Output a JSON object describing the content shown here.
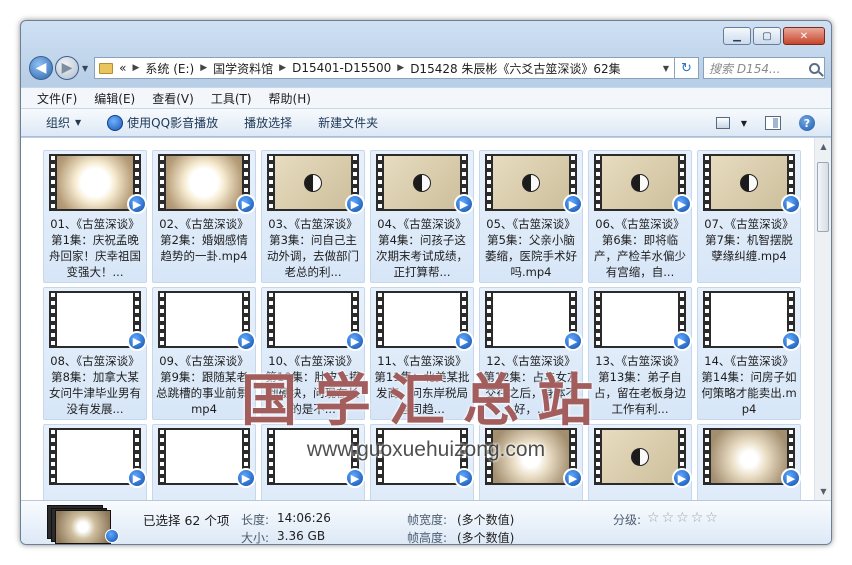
{
  "window": {
    "controls": {
      "minimize": "▁",
      "maximize": "▢",
      "close": "✕"
    }
  },
  "nav": {
    "back_glyph": "◀",
    "fwd_glyph": "▶",
    "breadcrumb_lead": "«",
    "breadcrumbs": [
      "系统 (E:)",
      "国学资料馆",
      "D15401-D15500",
      "D15428 朱辰彬《六爻古筮深谈》62集"
    ],
    "refresh_glyph": "↻",
    "search_placeholder": "搜索 D154..."
  },
  "menu": [
    "文件(F)",
    "编辑(E)",
    "查看(V)",
    "工具(T)",
    "帮助(H)"
  ],
  "toolbar": {
    "organize": "组织",
    "play_qq": "使用QQ影音播放",
    "play_selected": "播放选择",
    "new_folder": "新建文件夹",
    "help": "?"
  },
  "files": [
    {
      "caption": "01、《古筮深谈》第1集：庆祝孟晚舟回家！庆幸祖国变强大！...",
      "thumb": "sun"
    },
    {
      "caption": "02、《古筮深谈》第2集：婚姻感情趋势的一卦.mp4",
      "thumb": "sun"
    },
    {
      "caption": "03、《古筮深谈》第3集：问自己主动外调，去做部门老总的利...",
      "thumb": "paper"
    },
    {
      "caption": "04、《古筮深谈》第4集：问孩子这次期末考试成绩，正打算帮...",
      "thumb": "paper"
    },
    {
      "caption": "05、《古筮深谈》第5集：父亲小脑萎缩，医院手术好吗.mp4",
      "thumb": "paper"
    },
    {
      "caption": "06、《古筮深谈》第6集：即将临产，产检羊水偏少有宫缩，自...",
      "thumb": "paper"
    },
    {
      "caption": "07、《古筮深谈》第7集：机智摆脱孽缘纠缠.mp4",
      "thumb": "paper"
    },
    {
      "caption": "08、《古筮深谈》第8集：加拿大某女问牛津毕业男有没有发展...",
      "thumb": "white"
    },
    {
      "caption": "09、《古筮深谈》第9集：跟随某老总跳槽的事业前景.mp4",
      "thumb": "white"
    },
    {
      "caption": "10、《古筮深谈》第10集：肚皮上摸到硬块，问现在长的是不...",
      "thumb": "white"
    },
    {
      "caption": "11、《古筮深谈》第11集：北美某批发商，问东岸税局官司趋...",
      "thumb": "white"
    },
    {
      "caption": "12、《古筮深谈》第12集：占与女友交往之后，身体不好，...",
      "thumb": "white"
    },
    {
      "caption": "13、《古筮深谈》第13集：弟子自占，留在老板身边工作有利...",
      "thumb": "white"
    },
    {
      "caption": "14、《古筮深谈》第14集：问房子如何策略才能卖出.mp4",
      "thumb": "white"
    },
    {
      "caption": "",
      "thumb": "white"
    },
    {
      "caption": "",
      "thumb": "white"
    },
    {
      "caption": "",
      "thumb": "white"
    },
    {
      "caption": "",
      "thumb": "white"
    },
    {
      "caption": "",
      "thumb": "glow"
    },
    {
      "caption": "",
      "thumb": "paper"
    },
    {
      "caption": "",
      "thumb": "glow"
    }
  ],
  "watermark": {
    "text": "国学汇总站",
    "url": "www.guoxuehuizong.com"
  },
  "details": {
    "selected": "已选择 62 个项",
    "length_label": "长度:",
    "length_value": "14:06:26",
    "size_label": "大小:",
    "size_value": "3.36 GB",
    "frame_width_label": "帧宽度:",
    "frame_width_value": "(多个数值)",
    "frame_height_label": "帧高度:",
    "frame_height_value": "(多个数值)",
    "rating_label": "分级:",
    "rating_stars": 0
  },
  "colors": {
    "window_frame": "#b9cfe7",
    "selection_tile": "#d7e6f7",
    "watermark": "#801e1e",
    "qq_badge": "#124ea8"
  }
}
